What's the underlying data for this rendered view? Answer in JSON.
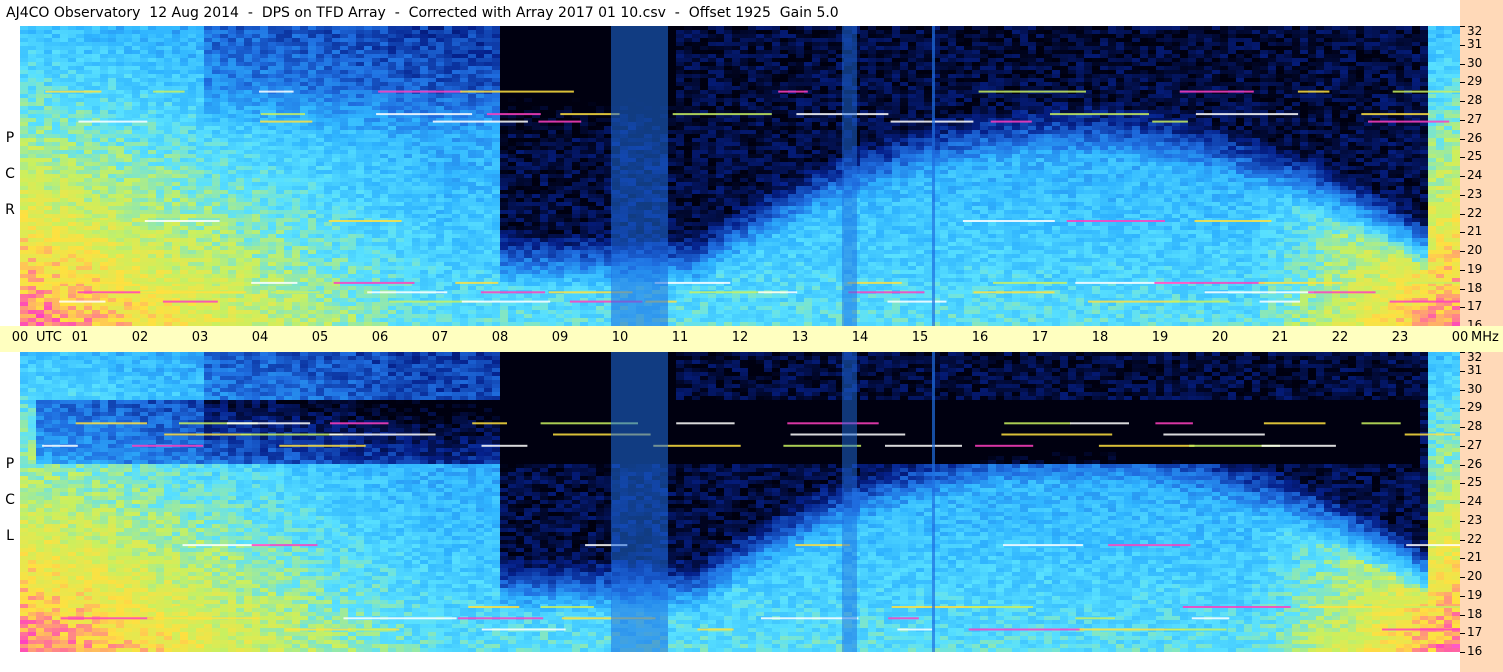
{
  "title": "AJ4CO Observatory  12 Aug 2014  -  DPS on TFD Array  -  Corrected with Array 2017 01 10.csv  -  Offset 1925  Gain 5.0",
  "chart_data": [
    {
      "type": "heatmap",
      "panel": "RCP",
      "pol_label": [
        "R",
        "C",
        "P"
      ],
      "x_unit_label": "UTC",
      "x_ticks": [
        "00",
        "01",
        "02",
        "03",
        "04",
        "05",
        "06",
        "07",
        "08",
        "09",
        "10",
        "11",
        "12",
        "13",
        "14",
        "15",
        "16",
        "17",
        "18",
        "19",
        "20",
        "21",
        "22",
        "23",
        "00"
      ],
      "y_unit_label": "MHz",
      "y_ticks": [
        "16",
        "17",
        "18",
        "19",
        "20",
        "21",
        "22",
        "23",
        "24",
        "25",
        "26",
        "27",
        "28",
        "29",
        "30",
        "31",
        "32"
      ],
      "xlim_hours": [
        0,
        24
      ],
      "ylim_mhz": [
        16,
        32
      ],
      "colormap": [
        "#000010",
        "#05208a",
        "#1f6ee0",
        "#2fb4ff",
        "#58e0ff",
        "#c8f060",
        "#ffe040",
        "#ff40c0",
        "#ffffff"
      ]
    },
    {
      "type": "heatmap",
      "panel": "LCP",
      "pol_label": [
        "L",
        "C",
        "P"
      ],
      "x_unit_label": "UTC",
      "x_ticks": [
        "00",
        "01",
        "02",
        "03",
        "04",
        "05",
        "06",
        "07",
        "08",
        "09",
        "10",
        "11",
        "12",
        "13",
        "14",
        "15",
        "16",
        "17",
        "18",
        "19",
        "20",
        "21",
        "22",
        "23",
        "00"
      ],
      "y_unit_label": "MHz",
      "y_ticks": [
        "16",
        "17",
        "18",
        "19",
        "20",
        "21",
        "22",
        "23",
        "24",
        "25",
        "26",
        "27",
        "28",
        "29",
        "30",
        "31",
        "32"
      ],
      "xlim_hours": [
        0,
        24
      ],
      "ylim_mhz": [
        16,
        32
      ],
      "colormap": [
        "#000010",
        "#05208a",
        "#1f6ee0",
        "#2fb4ff",
        "#58e0ff",
        "#c8f060",
        "#ffe040",
        "#ff40c0",
        "#ffffff"
      ]
    }
  ]
}
